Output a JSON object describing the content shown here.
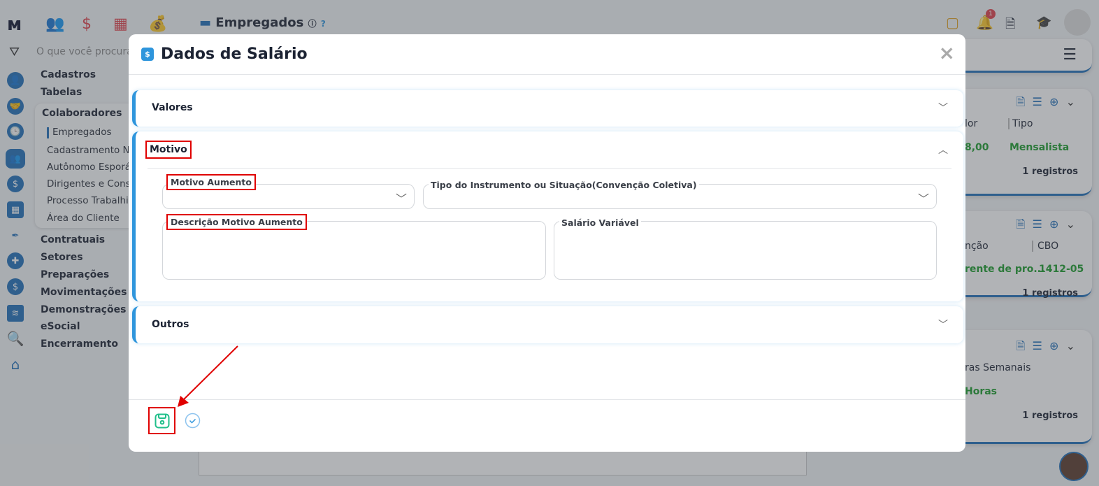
{
  "app": {
    "page_title": "Empregados",
    "search_placeholder": "O que você procura?",
    "notification_count": "1"
  },
  "sidebar": {
    "menus": [
      "Cadastros",
      "Tabelas",
      "Colaboradores",
      "Contratuais",
      "Setores",
      "Preparações",
      "Movimentações",
      "Demonstrações",
      "eSocial",
      "Encerramento"
    ],
    "submenu": [
      "Empregados",
      "Cadastramento N",
      "Autônomo Esporá",
      "Dirigentes e Conse",
      "Processo Trabalhis",
      "Área do Cliente"
    ]
  },
  "cards": [
    {
      "headers": [
        "lor",
        "Tipo"
      ],
      "values": [
        "8,00",
        "Mensalista"
      ],
      "count": "1 registros"
    },
    {
      "headers": [
        "nção",
        "CBO"
      ],
      "values": [
        "rente de pro...",
        "1412-05"
      ],
      "count": "1 registros"
    },
    {
      "headers": [
        "ras Semanais"
      ],
      "values": [
        "Horas"
      ],
      "count": "1 registros"
    }
  ],
  "modal": {
    "title": "Dados de Salário",
    "close": "×",
    "sections": {
      "valores": "Valores",
      "motivo": "Motivo",
      "outros": "Outros"
    },
    "fields": {
      "motivo_aumento": "Motivo Aumento",
      "tipo_instrumento": "Tipo do Instrumento ou Situação(Convenção Coletiva)",
      "descricao": "Descrição Motivo Aumento",
      "salario_variavel": "Salário Variável"
    }
  },
  "colors": {
    "accent": "#2e95dc",
    "save": "#1fbf8a",
    "highlight": "#e00000"
  }
}
